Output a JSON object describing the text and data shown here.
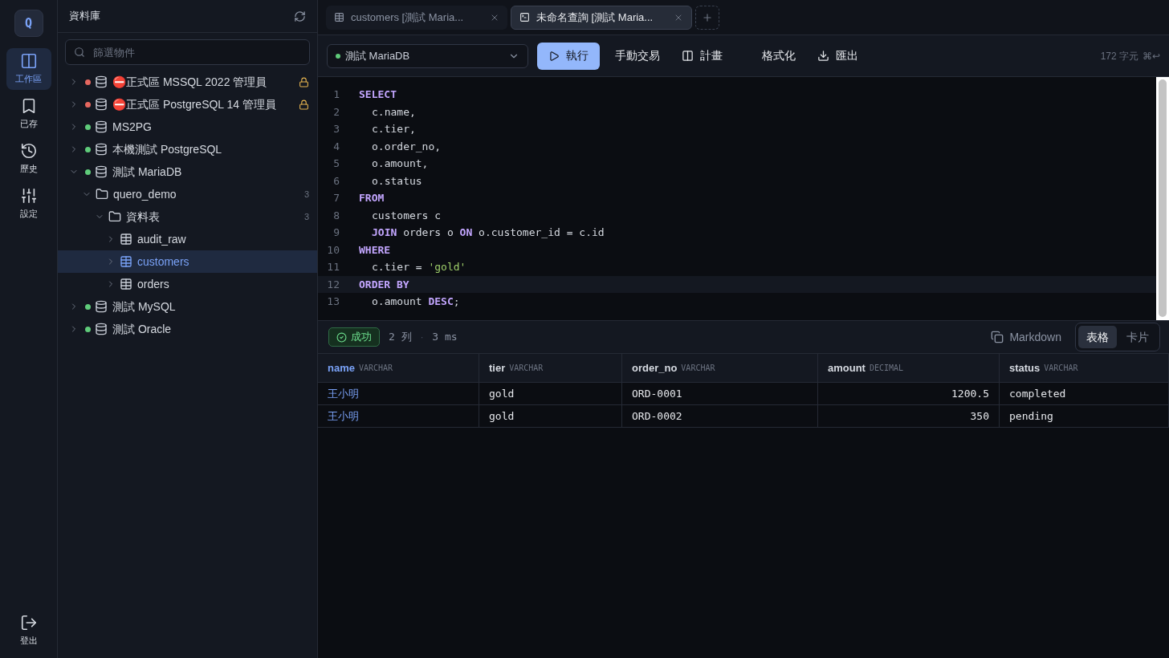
{
  "rail": {
    "logo": "Q",
    "items": [
      {
        "label": "工作區",
        "selected": true
      },
      {
        "label": "已存",
        "selected": false
      },
      {
        "label": "歷史",
        "selected": false
      },
      {
        "label": "設定",
        "selected": false
      }
    ],
    "logout": {
      "label": "登出"
    }
  },
  "sidebar": {
    "title": "資料庫",
    "search": {
      "placeholder": "篩選物件"
    },
    "tree": [
      {
        "kind": "connection",
        "name": "⛔正式區 MSSQL 2022 管理員",
        "color": "#e5675f",
        "locked": true,
        "expanded": false,
        "selected": false
      },
      {
        "kind": "connection",
        "name": "⛔正式區 PostgreSQL 14 管理員",
        "color": "#e5675f",
        "locked": true,
        "expanded": false,
        "selected": false
      },
      {
        "kind": "connection",
        "name": "MS2PG",
        "color": "#5fcb7a",
        "locked": false,
        "expanded": false,
        "selected": false
      },
      {
        "kind": "connection",
        "name": "本機測試 PostgreSQL",
        "color": "#5fcb7a",
        "locked": false,
        "expanded": false,
        "selected": false
      },
      {
        "kind": "connection",
        "name": "測試 MariaDB",
        "color": "#5fcb7a",
        "locked": false,
        "expanded": true,
        "selected": false,
        "children": [
          {
            "kind": "folder",
            "name": "quero_demo",
            "count": "3",
            "expanded": true,
            "selected": false,
            "children": [
              {
                "kind": "folder",
                "name": "資料表",
                "count": "3",
                "expanded": true,
                "selected": false,
                "children": [
                  {
                    "kind": "table",
                    "name": "audit_raw",
                    "expanded": false,
                    "selected": false
                  },
                  {
                    "kind": "table",
                    "name": "customers",
                    "expanded": false,
                    "selected": true
                  },
                  {
                    "kind": "table",
                    "name": "orders",
                    "expanded": false,
                    "selected": false
                  }
                ]
              }
            ]
          }
        ]
      },
      {
        "kind": "connection",
        "name": "測試 MySQL",
        "color": "#5fcb7a",
        "locked": false,
        "expanded": false,
        "selected": false
      },
      {
        "kind": "connection",
        "name": "測試 Oracle",
        "color": "#5fcb7a",
        "locked": false,
        "expanded": false,
        "selected": false
      }
    ]
  },
  "tabs": [
    {
      "label": "customers [測試 Maria...",
      "kind": "table",
      "selected": false
    },
    {
      "label": "未命名查詢 [測試 Maria...",
      "kind": "query",
      "selected": true
    }
  ],
  "toolbar": {
    "connection": "測試 MariaDB",
    "connected": true,
    "run": "執行",
    "transaction": "手動交易",
    "plan": "計畫",
    "format": "格式化",
    "export": "匯出",
    "char_count": "172 字元",
    "shortcut": "⌘↩"
  },
  "editor": {
    "lines": [
      {
        "no": "1",
        "current": false,
        "indented": false,
        "tokens": [
          {
            "kind": "keyword",
            "text": "SELECT"
          }
        ]
      },
      {
        "no": "2",
        "current": false,
        "indented": true,
        "tokens": [
          {
            "kind": "plain",
            "text": "c.name,"
          }
        ]
      },
      {
        "no": "3",
        "current": false,
        "indented": true,
        "tokens": [
          {
            "kind": "plain",
            "text": "c.tier,"
          }
        ]
      },
      {
        "no": "4",
        "current": false,
        "indented": true,
        "tokens": [
          {
            "kind": "plain",
            "text": "o.order_no,"
          }
        ]
      },
      {
        "no": "5",
        "current": false,
        "indented": true,
        "tokens": [
          {
            "kind": "plain",
            "text": "o.amount,"
          }
        ]
      },
      {
        "no": "6",
        "current": false,
        "indented": true,
        "tokens": [
          {
            "kind": "plain",
            "text": "o.status"
          }
        ]
      },
      {
        "no": "7",
        "current": false,
        "indented": false,
        "tokens": [
          {
            "kind": "keyword",
            "text": "FROM"
          }
        ]
      },
      {
        "no": "8",
        "current": false,
        "indented": true,
        "tokens": [
          {
            "kind": "plain",
            "text": "customers c"
          }
        ]
      },
      {
        "no": "9",
        "current": false,
        "indented": true,
        "tokens": [
          {
            "kind": "keyword",
            "text": "JOIN"
          },
          {
            "kind": "plain",
            "text": " orders o "
          },
          {
            "kind": "keyword",
            "text": "ON"
          },
          {
            "kind": "plain",
            "text": " o.customer_id = c.id"
          }
        ]
      },
      {
        "no": "10",
        "current": false,
        "indented": false,
        "tokens": [
          {
            "kind": "keyword",
            "text": "WHERE"
          }
        ]
      },
      {
        "no": "11",
        "current": false,
        "indented": true,
        "tokens": [
          {
            "kind": "plain",
            "text": "c.tier = "
          },
          {
            "kind": "string",
            "text": "'gold'"
          }
        ]
      },
      {
        "no": "12",
        "current": true,
        "indented": false,
        "tokens": [
          {
            "kind": "keyword",
            "text": "ORDER BY"
          }
        ]
      },
      {
        "no": "13",
        "current": false,
        "indented": true,
        "tokens": [
          {
            "kind": "plain",
            "text": "o.amount "
          },
          {
            "kind": "keyword",
            "text": "DESC"
          },
          {
            "kind": "plain",
            "text": ";"
          }
        ]
      }
    ]
  },
  "results": {
    "status": "成功",
    "rows_info": "2 列",
    "separator": "·",
    "time": "3 ms",
    "markdown": "Markdown",
    "views": [
      {
        "label": "表格",
        "selected": true
      },
      {
        "label": "卡片",
        "selected": false
      }
    ],
    "columns": [
      {
        "name": "name",
        "type": "VARCHAR",
        "numeric": false,
        "key": true
      },
      {
        "name": "tier",
        "type": "VARCHAR",
        "numeric": false,
        "key": false
      },
      {
        "name": "order_no",
        "type": "VARCHAR",
        "numeric": false,
        "key": false
      },
      {
        "name": "amount",
        "type": "DECIMAL",
        "numeric": true,
        "key": false
      },
      {
        "name": "status",
        "type": "VARCHAR",
        "numeric": false,
        "key": false
      }
    ],
    "rows": [
      [
        "王小明",
        "gold",
        "ORD-0001",
        "1200.5",
        "completed"
      ],
      [
        "王小明",
        "gold",
        "ORD-0002",
        "350",
        "pending"
      ]
    ]
  }
}
